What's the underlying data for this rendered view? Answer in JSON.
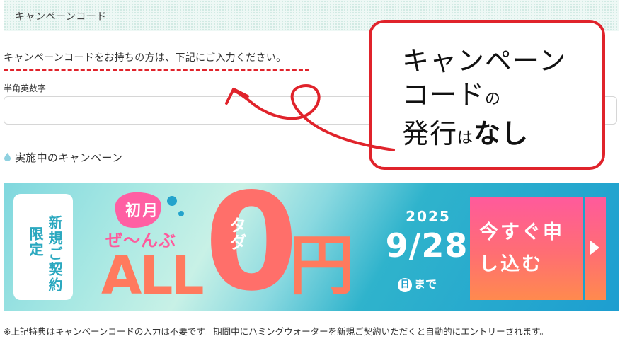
{
  "section": {
    "title": "キャンペーンコード"
  },
  "intro": "キャンペーンコードをお持ちの方は、下記にご入力ください。",
  "input": {
    "label": "半角英数字",
    "value": "",
    "placeholder": ""
  },
  "campaign": {
    "title": "実施中のキャンペーン"
  },
  "banner": {
    "badge": [
      "限定",
      "新規ご契約"
    ],
    "first_month": "初月",
    "zenbu": "ぜ〜んぶ",
    "all": "ALL",
    "big_zero": "0",
    "yen": "円",
    "tada": "タダ",
    "year": "2025",
    "date": "9/28",
    "weekday": "日",
    "until": "まで",
    "cta": "今すぐ申し込む"
  },
  "annotation": {
    "line1": "キャンペーン",
    "line2a": "コード",
    "line2b": "の",
    "line3a": "発行",
    "line3b": "は",
    "line3c": "なし"
  },
  "footnote": "※上記特典はキャンペーンコードの入力は不要です。期間中にハミングウォーターを新規ご契約いただくと自動的にエントリーされます。",
  "colors": {
    "accent_red": "#e0232b",
    "teal": "#2aa8bf",
    "cta_pink": "#ff5a9c",
    "cta_orange": "#ff8a4e"
  }
}
